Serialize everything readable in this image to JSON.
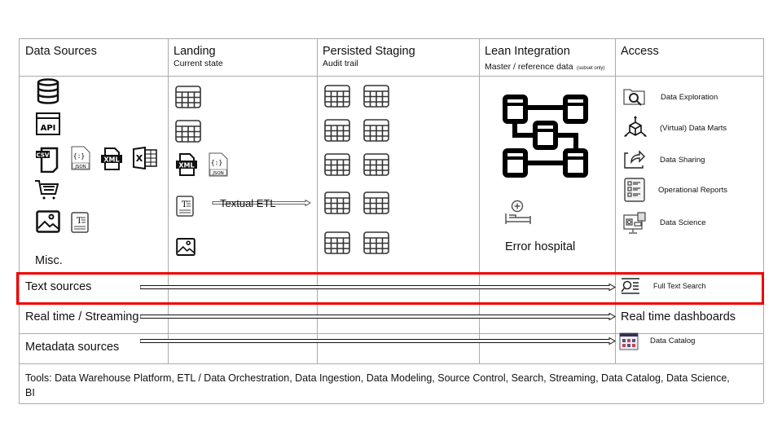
{
  "columns": [
    {
      "title": "Data Sources",
      "subtitle": ""
    },
    {
      "title": "Landing",
      "subtitle": "Current state"
    },
    {
      "title": "Persisted Staging",
      "subtitle": "Audit trail"
    },
    {
      "title": "Lean Integration",
      "subtitle": "Master / reference data",
      "note": "(subset only)"
    },
    {
      "title": "Access",
      "subtitle": ""
    }
  ],
  "data_sources": {
    "icons": [
      "database-icon",
      "api-icon",
      "csv-file-icon",
      "json-file-icon",
      "xml-file-icon",
      "excel-file-icon",
      "shopping-cart-icon",
      "image-icon",
      "text-document-icon"
    ],
    "misc_label": "Misc."
  },
  "landing": {
    "textual_etl_label": "Textual ETL"
  },
  "lean_integration": {
    "error_hospital_label": "Error hospital"
  },
  "access": {
    "items": [
      {
        "label": "Data Exploration",
        "icon": "folder-search-icon"
      },
      {
        "label": "(Virtual) Data Marts",
        "icon": "cube-icon"
      },
      {
        "label": "Data Sharing",
        "icon": "share-icon"
      },
      {
        "label": "Operational Reports",
        "icon": "report-icon"
      },
      {
        "label": "Data Science",
        "icon": "data-science-icon"
      }
    ]
  },
  "rows": [
    {
      "source": "Text sources",
      "target": "Full Text Search",
      "highlighted": true
    },
    {
      "source": "Real time / Streaming",
      "target": "Real time dashboards"
    },
    {
      "source": "Metadata sources",
      "target": "Data Catalog"
    }
  ],
  "tools": "Tools: Data Warehouse Platform, ETL / Data Orchestration, Data Ingestion, Data Modeling, Source Control, Search, Streaming, Data Catalog, Data Science, BI",
  "colors": {
    "highlight": "#ee0000",
    "grid": "#aaaaaa"
  }
}
